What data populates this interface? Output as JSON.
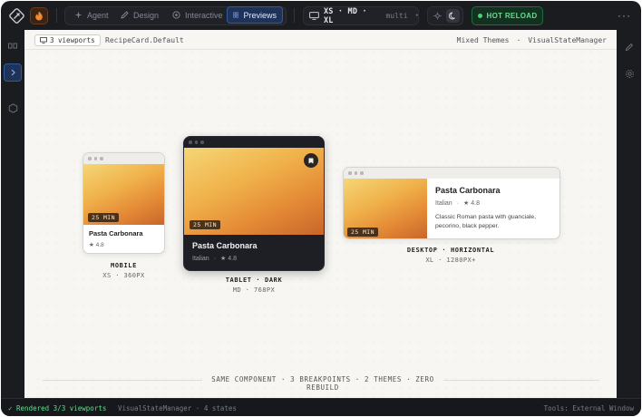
{
  "toolbar": {
    "tabs": [
      {
        "label": "Agent",
        "icon": "sparkle-icon"
      },
      {
        "label": "Design",
        "icon": "pen-icon"
      },
      {
        "label": "Interactive",
        "icon": "target-icon"
      },
      {
        "label": "Previews",
        "icon": "grid-icon",
        "active": true
      }
    ],
    "viewports": "XS · MD · XL",
    "viewports_mode": "multi",
    "hot_reload": "HOT RELOAD",
    "menu": "···"
  },
  "canvas": {
    "viewport_count": "3 viewports",
    "breadcrumb": "RecipeCard.Default",
    "theme_label": "Mixed Themes",
    "separator": "·",
    "manager_label": "VisualStateManager"
  },
  "recipe": {
    "title": "Pasta Carbonara",
    "cuisine": "Italian",
    "rating": "★ 4.8",
    "time": "25 MIN",
    "description": "Classic Roman pasta with guanciale, pecorino, black pepper."
  },
  "previews": [
    {
      "title": "MOBILE",
      "subtitle": "XS · 360PX"
    },
    {
      "title": "TABLET · DARK",
      "subtitle": "MD · 768PX"
    },
    {
      "title": "DESKTOP · HORIZONTAL",
      "subtitle": "XL · 1280PX+"
    }
  ],
  "footer_note": "SAME COMPONENT · 3 BREAKPOINTS · 2 THEMES · ZERO REBUILD",
  "statusbar": {
    "rendered": "✓ Rendered 3/3 viewports",
    "manager": "VisualStateManager · 4 states",
    "tools": "Tools: External Window"
  },
  "colors": {
    "accent": "#2e5aa0",
    "hot_reload": "#5fe08b",
    "canvas_bg": "#f7f6f2",
    "app_bg": "#1b1c20",
    "dark_card": "#1e1f24",
    "flame": "#f28a2e"
  }
}
